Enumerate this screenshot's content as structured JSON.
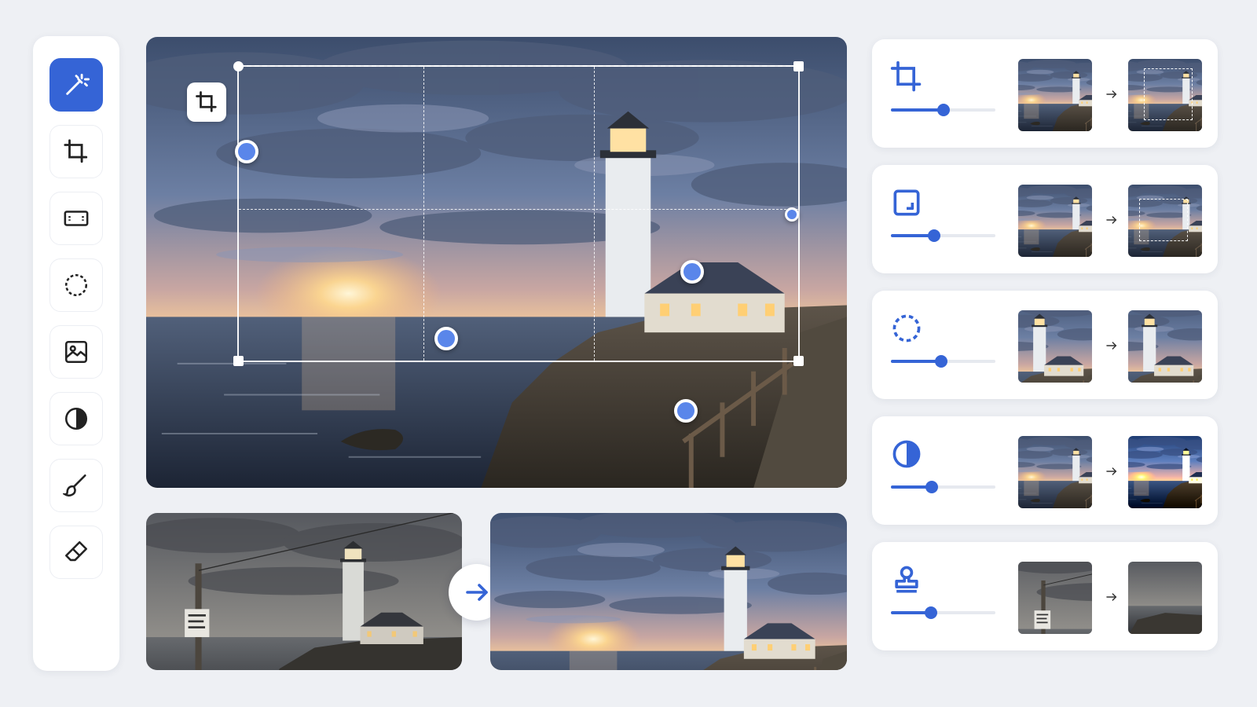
{
  "toolbar": {
    "tools": [
      {
        "id": "magic-wand-icon",
        "active": true
      },
      {
        "id": "crop-icon",
        "active": false
      },
      {
        "id": "aspect-ratio-icon",
        "active": false
      },
      {
        "id": "lasso-select-icon",
        "active": false
      },
      {
        "id": "image-icon",
        "active": false
      },
      {
        "id": "contrast-icon",
        "active": false
      },
      {
        "id": "brush-icon",
        "active": false
      },
      {
        "id": "eraser-icon",
        "active": false
      }
    ]
  },
  "colors": {
    "accent": "#3564d6",
    "point": "#5a86ea",
    "background": "#eef0f4"
  },
  "adjustments": [
    {
      "name": "crop",
      "icon": "crop-icon",
      "slider_level": 0.5
    },
    {
      "name": "resize",
      "icon": "resize-icon",
      "slider_level": 0.41
    },
    {
      "name": "select",
      "icon": "lasso-select-icon",
      "slider_level": 0.48
    },
    {
      "name": "contrast",
      "icon": "contrast-icon",
      "slider_level": 0.39
    },
    {
      "name": "clone-stamp",
      "icon": "stamp-icon",
      "slider_level": 0.38
    }
  ]
}
